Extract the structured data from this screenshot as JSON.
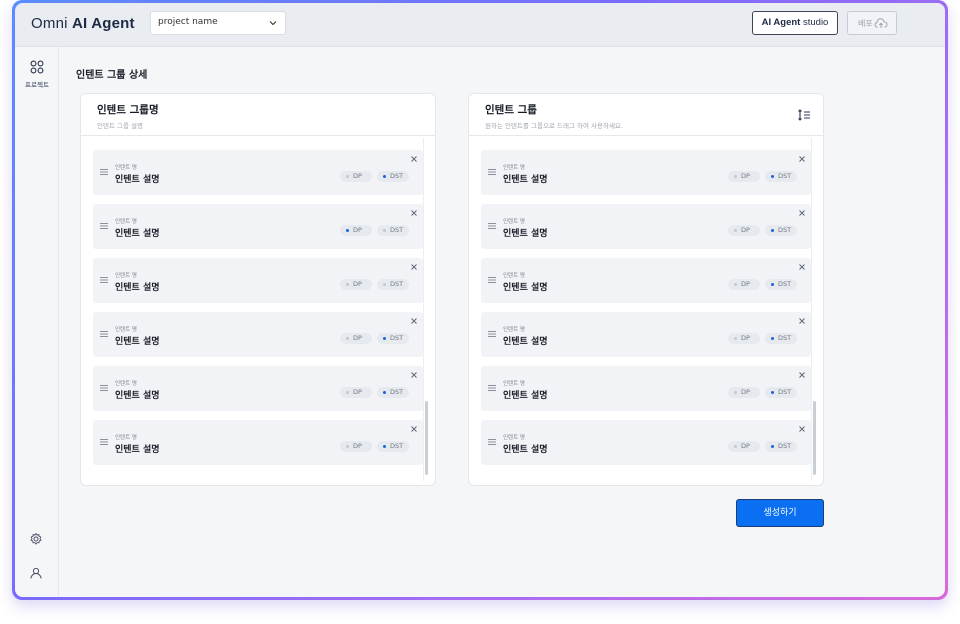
{
  "header": {
    "logo_light": "Omni ",
    "logo_bold": "AI Agent",
    "project_select_value": "project name",
    "studio_bold": "AI Agent",
    "studio_light": " studio",
    "deploy_label": "배포"
  },
  "sidebar": {
    "project_label": "프로젝트"
  },
  "page": {
    "title": "인텐트 그룹 상세",
    "create_label": "생성하기"
  },
  "left_panel": {
    "title": "인텐트 그룹명",
    "subtitle": "인텐트 그룹 설명",
    "items": [
      {
        "caption": "인텐트 명",
        "desc": "인텐트 설명",
        "dp": "DP",
        "dst": "DST",
        "dp_on": false,
        "dst_on": true
      },
      {
        "caption": "인텐트 명",
        "desc": "인텐트 설명",
        "dp": "DP",
        "dst": "DST",
        "dp_on": true,
        "dst_on": false
      },
      {
        "caption": "인텐트 명",
        "desc": "인텐트 설명",
        "dp": "DP",
        "dst": "DST",
        "dp_on": false,
        "dst_on": false
      },
      {
        "caption": "인텐트 명",
        "desc": "인텐트 설명",
        "dp": "DP",
        "dst": "DST",
        "dp_on": false,
        "dst_on": true
      },
      {
        "caption": "인텐트 명",
        "desc": "인텐트 설명",
        "dp": "DP",
        "dst": "DST",
        "dp_on": false,
        "dst_on": true
      },
      {
        "caption": "인텐트 명",
        "desc": "인텐트 설명",
        "dp": "DP",
        "dst": "DST",
        "dp_on": false,
        "dst_on": true
      }
    ]
  },
  "right_panel": {
    "title": "인텐트 그룹",
    "subtitle": "원하는 인텐트를 그룹으로 드래그 하여 사용하세요.",
    "items": [
      {
        "caption": "인텐트 명",
        "desc": "인텐트 설명",
        "dp": "DP",
        "dst": "DST",
        "dp_on": false,
        "dst_on": true
      },
      {
        "caption": "인텐트 명",
        "desc": "인텐트 설명",
        "dp": "DP",
        "dst": "DST",
        "dp_on": false,
        "dst_on": true
      },
      {
        "caption": "인텐트 명",
        "desc": "인텐트 설명",
        "dp": "DP",
        "dst": "DST",
        "dp_on": false,
        "dst_on": true
      },
      {
        "caption": "인텐트 명",
        "desc": "인텐트 설명",
        "dp": "DP",
        "dst": "DST",
        "dp_on": false,
        "dst_on": true
      },
      {
        "caption": "인텐트 명",
        "desc": "인텐트 설명",
        "dp": "DP",
        "dst": "DST",
        "dp_on": false,
        "dst_on": true
      },
      {
        "caption": "인텐트 명",
        "desc": "인텐트 설명",
        "dp": "DP",
        "dst": "DST",
        "dp_on": false,
        "dst_on": true
      }
    ]
  },
  "colors": {
    "accent": "#0a6ff0",
    "tag_active_dot": "#1a66d9",
    "tag_inactive_dot": "#c3c8d0"
  },
  "icons": {
    "nav_project": "grid-icon",
    "settings": "gear-icon",
    "user": "user-icon",
    "deploy": "cloud-upload-icon",
    "sort": "sort-icon",
    "drag": "drag-handle-icon",
    "close": "close-icon",
    "select": "chevron-down-icon"
  }
}
